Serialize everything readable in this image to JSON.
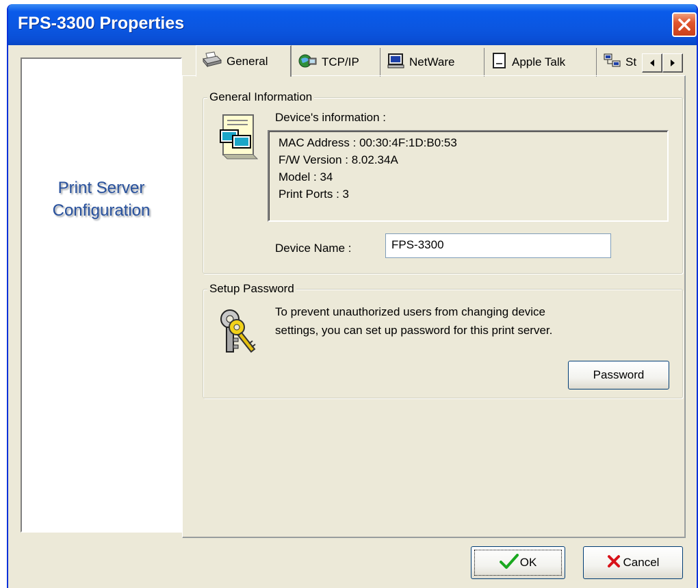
{
  "window": {
    "title": "FPS-3300 Properties"
  },
  "sidebar": {
    "title_line1": "Print Server",
    "title_line2": "Configuration"
  },
  "tabs": [
    {
      "label": "General",
      "icon": "printer-icon",
      "active": true
    },
    {
      "label": "TCP/IP",
      "icon": "network-globe-icon",
      "active": false
    },
    {
      "label": "NetWare",
      "icon": "computer-icon",
      "active": false
    },
    {
      "label": "Apple Talk",
      "icon": "document-icon",
      "active": false
    },
    {
      "label": "St",
      "icon": "network-computers-icon",
      "active": false
    }
  ],
  "general_info": {
    "legend": "General Information",
    "device_info_label": "Device's information :",
    "lines": [
      "MAC Address : 00:30:4F:1D:B0:53",
      "F/W Version : 8.02.34A",
      "Model : 34",
      "Print Ports : 3"
    ],
    "device_name_label": "Device Name :",
    "device_name_value": "FPS-3300"
  },
  "setup_password": {
    "legend": "Setup Password",
    "description_line1": "To prevent unauthorized users from changing device",
    "description_line2": "settings, you can set up password for this print server.",
    "password_button": "Password"
  },
  "footer": {
    "ok_label": "OK",
    "cancel_label": "Cancel"
  }
}
